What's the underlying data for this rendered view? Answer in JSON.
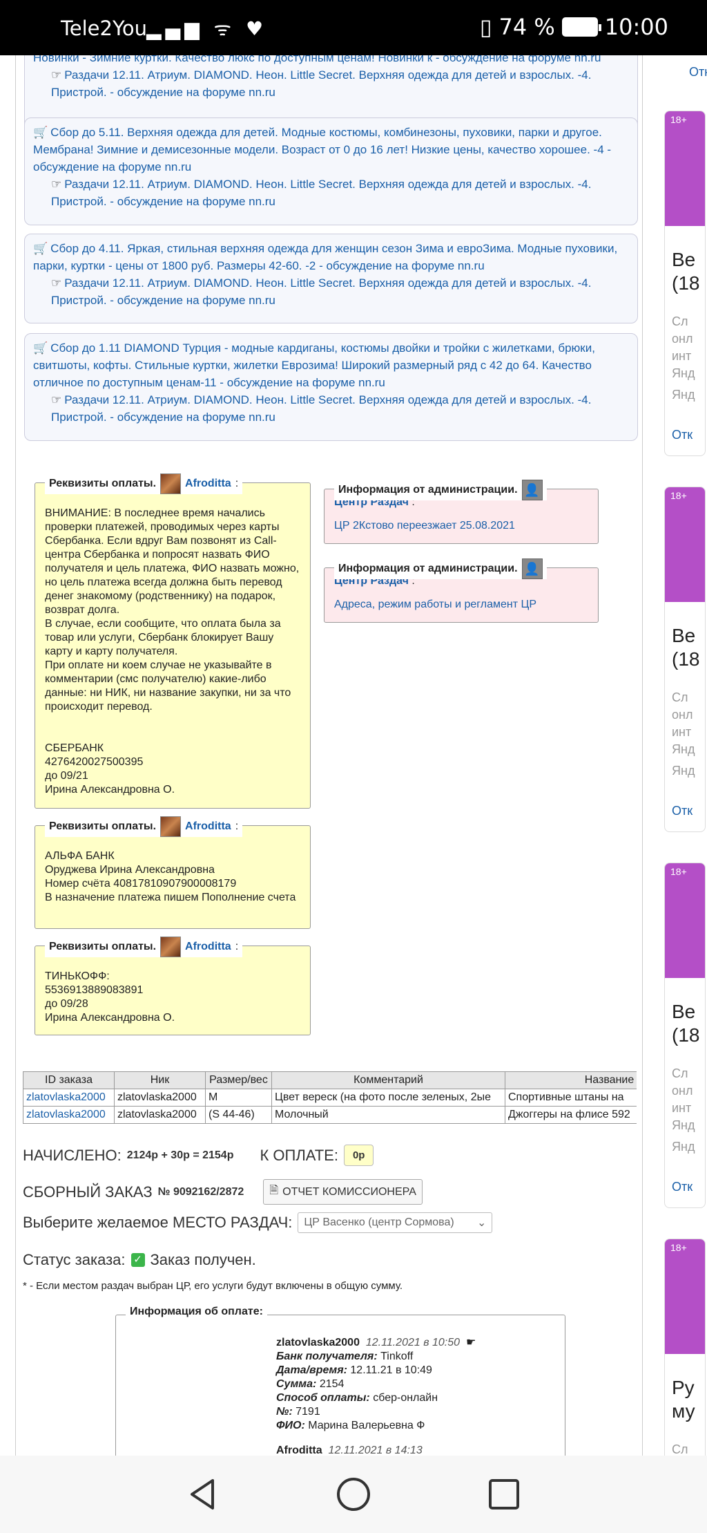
{
  "status_bar": {
    "carrier": "Tele2You",
    "battery": "74 %",
    "time": "10:00"
  },
  "cards": [
    {
      "lines": [
        "Новинки - Зимние куртки. Качество люкс по доступным ценам! Новинки к - обсуждение на форуме nn.ru"
      ],
      "sub": "Раздачи 12.11. Атриум. DIAMOND. Неон. Little Secret. Верхняя одежда для детей и взрослых. -4. Пристрой. - обсуждение на форуме nn.ru"
    },
    {
      "text": "Сбор до 5.11. Верхняя одежда для детей. Модные костюмы, комбинезоны, пуховики, парки и другое. Мембрана! Зимние и демисезонные модели. Возраст от 0 до 16 лет! Низкие цены, качество хорошее. -4 - обсуждение на форуме nn.ru",
      "sub": "Раздачи 12.11. Атриум. DIAMOND. Неон. Little Secret. Верхняя одежда для детей и взрослых. -4. Пристрой. - обсуждение на форуме nn.ru"
    },
    {
      "text": "Сбор до 4.11. Яркая, стильная верхняя одежда для женщин сезон Зима и евроЗима. Модные пуховики, парки, куртки - цены от 1800 руб. Размеры 42-60. -2 - обсуждение на форуме nn.ru",
      "sub": "Раздачи 12.11. Атриум. DIAMOND. Неон. Little Secret. Верхняя одежда для детей и взрослых. -4. Пристрой. - обсуждение на форуме nn.ru"
    },
    {
      "text": "Сбор до 1.11 DIAMOND Турция - модные кардиганы, костюмы двойки и тройки с жилетками, брюки, свитшоты, кофты. Стильные куртки, жилетки Еврозима! Широкий размерный ряд с 42 до 64. Качество отличное по доступным ценам-11 - обсуждение на форуме nn.ru",
      "sub": "Раздачи 12.11. Атриум. DIAMOND. Неон. Little Secret. Верхняя одежда для детей и взрослых. -4. Пристрой. - обсуждение на форуме nn.ru"
    }
  ],
  "payment": [
    {
      "legend": "Реквизиты оплаты.",
      "user": "Afroditta",
      "text": "ВНИМАНИЕ: В последнее время начались проверки платежей, проводимых через карты Сбербанка. Если вдруг Вам позвонят из Call-центра Сбербанка и попросят назвать ФИО получателя и цель платежа, ФИО назвать можно, но цель платежа всегда должна быть перевод денег знакомому (родственнику) на подарок, возврат долга.\nВ случае, если сообщите, что оплата была за товар или услуги, Сбербанк блокирует Вашу карту и карту получателя.\nПри оплате ни коем случае не указывайте в комментарии (смс получателю) какие-либо данные: ни НИК, ни название закупки, ни за что происходит перевод.\n\n\nСБЕРБАНК\n4276420027500395\nдо 09/21\nИрина Александровна О."
    },
    {
      "legend": "Реквизиты оплаты.",
      "user": "Afroditta",
      "text": "АЛЬФА БАНК\nОруджева Ирина Александровна\nНомер счёта 40817810907900008179\nВ назначение платежа пишем Пополнение счета"
    },
    {
      "legend": "Реквизиты оплаты.",
      "user": "Afroditta",
      "text": "ТИНЬКОФФ:\n5536913889083891\nдо 09/28\nИрина Александровна О."
    }
  ],
  "admin": [
    {
      "legend": "Информация от администрации.",
      "from": "Центр Раздач",
      "text": "ЦР 2Кстово переезжает 25.08.2021"
    },
    {
      "legend": "Информация от администрации.",
      "from": "Центр Раздач",
      "text": "Адреса, режим работы и регламент ЦР"
    }
  ],
  "orders": {
    "headers": [
      "ID заказа",
      "Ник",
      "Размер/вес",
      "Комментарий",
      "Название"
    ],
    "rows": [
      [
        "zlatovlaska2000",
        "zlatovlaska2000",
        "M",
        "Цвет вереск (на фото после зеленых, 2ые",
        "Спортивные штаны на"
      ],
      [
        "zlatovlaska2000",
        "zlatovlaska2000",
        "(S 44-46)",
        "Молочный",
        "Джоггеры на флисе 592"
      ]
    ]
  },
  "summary": {
    "charged_label": "НАЧИСЛЕНО:",
    "charged_value": "2124р + 30р = 2154р",
    "topay_label": "К ОПЛАТЕ:",
    "topay_value": "0р",
    "order_label": "СБОРНЫЙ ЗАКАЗ",
    "order_no": "№ 9092162/2872",
    "report_button": "ОТЧЕТ КОМИССИОНЕРА",
    "place_label": "Выберите желаемое МЕСТО РАЗДАЧ:",
    "place_value": "ЦР Васенко (центр Сормова)",
    "status_label": "Статус заказа:",
    "status_value": "Заказ получен.",
    "note": "* - Если местом раздач выбран ЦР, его услуги будут включены в общую сумму."
  },
  "payinfo": {
    "legend": "Информация об оплате:",
    "user": "zlatovlaska2000",
    "date": "12.11.2021 в 10:50",
    "rows": [
      [
        "Банк получателя:",
        "Tinkoff"
      ],
      [
        "Дата/время:",
        "12.11.21 в 10:49"
      ],
      [
        "Сумма:",
        "2154"
      ],
      [
        "Способ оплаты:",
        "сбер-онлайн"
      ],
      [
        "№:",
        "7191"
      ],
      [
        "ФИО:",
        "Марина Валерьевна Ф"
      ]
    ],
    "next_user": "Afroditta",
    "next_date": "12.11.2021 в 14:13"
  },
  "sidebar": {
    "top_link": "Отк",
    "ads": [
      {
        "age": "18+",
        "title1": "Ве",
        "title2": "(18",
        "g": [
          "Сл",
          "онл",
          "инт",
          "Янд"
        ],
        "g2": "Янд",
        "link": "Отк"
      },
      {
        "age": "18+",
        "title1": "Ве",
        "title2": "(18",
        "g": [
          "Сл",
          "онл",
          "инт",
          "Янд"
        ],
        "g2": "Янд",
        "link": "Отк"
      },
      {
        "age": "18+",
        "title1": "Ве",
        "title2": "(18",
        "g": [
          "Сл",
          "онл",
          "инт",
          "Янд"
        ],
        "g2": "Янд",
        "link": "Отк"
      },
      {
        "age": "18+",
        "title1": "Ру",
        "title2": "му",
        "g": [
          "Сл"
        ]
      }
    ]
  }
}
